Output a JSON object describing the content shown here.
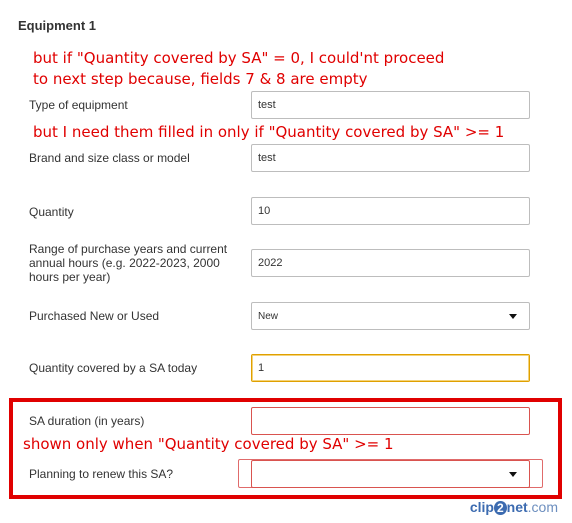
{
  "section": {
    "title": "Equipment 1"
  },
  "annotations": {
    "note1_line1": "but if \"Quantity covered by SA\" = 0, I could'nt proceed",
    "note1_line2": "to next step because, fields 7 & 8 are empty",
    "note2": "but I need them filled in only if \"Quantity covered by SA\" >= 1",
    "note3": "shown only when \"Quantity covered by SA\"  >= 1"
  },
  "fields": {
    "type": {
      "label": "Type of equipment",
      "value": "test"
    },
    "brand": {
      "label": "Brand and size class or model",
      "value": "test"
    },
    "quantity": {
      "label": "Quantity",
      "value": "10"
    },
    "range": {
      "label": "Range of purchase years and current annual hours (e.g. 2022-2023, 2000 hours per year)",
      "value": "2022"
    },
    "purchased": {
      "label": "Purchased New or Used",
      "value": "New"
    },
    "covered": {
      "label": "Quantity covered by a SA today",
      "value": "1"
    },
    "duration": {
      "label": "SA duration (in years)",
      "value": ""
    },
    "renew": {
      "label": "Planning to renew this SA?",
      "value": ""
    }
  },
  "watermark": {
    "part1": "clip",
    "part2": "2",
    "part3": "net",
    "part4": ".com"
  },
  "colors": {
    "annotation": "#e00000",
    "focus": "#e0a000",
    "invalid": "#d9534f"
  }
}
